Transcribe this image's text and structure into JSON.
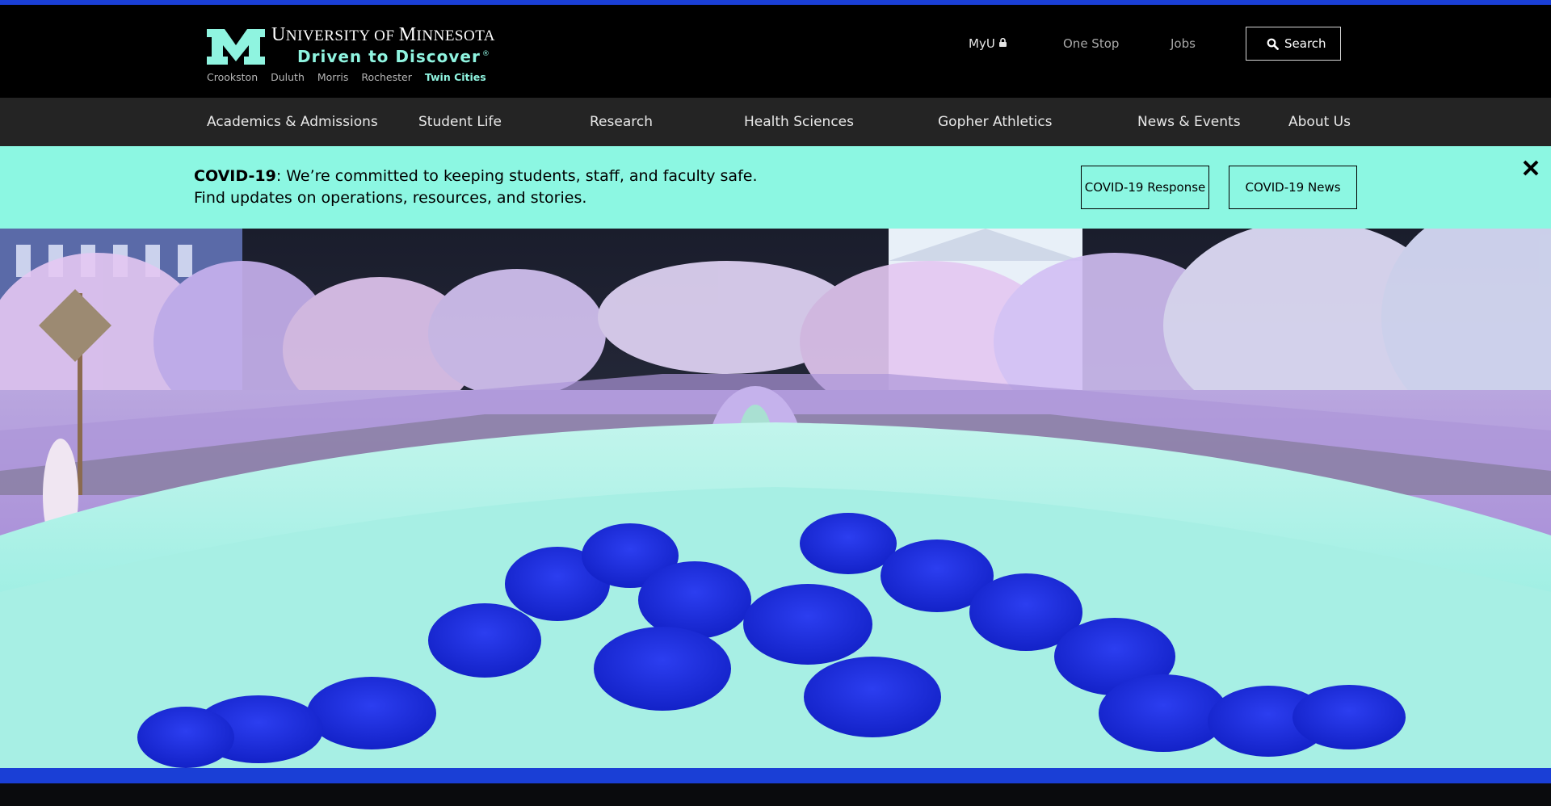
{
  "brand": {
    "university_first": "U",
    "university_rest": "NIVERSITY OF ",
    "university_second": "M",
    "university_second_rest": "INNESOTA",
    "tagline": "Driven to Discover",
    "tagline_mark": "®",
    "campuses": [
      {
        "label": "Crookston",
        "active": false
      },
      {
        "label": "Duluth",
        "active": false
      },
      {
        "label": "Morris",
        "active": false
      },
      {
        "label": "Rochester",
        "active": false
      },
      {
        "label": "Twin Cities",
        "active": true
      }
    ],
    "colors": {
      "accent": "#8ff4e0",
      "stripe": "#1a3fd6",
      "header_bg": "#000000"
    }
  },
  "utility_nav": {
    "myu": "MyU",
    "one_stop": "One Stop",
    "jobs": "Jobs",
    "search": "Search"
  },
  "main_nav": [
    "Academics & Admissions",
    "Student Life",
    "Research",
    "Health Sciences",
    "Gopher Athletics",
    "News & Events",
    "About Us"
  ],
  "alert": {
    "label": "COVID-19",
    "line1": ": We’re committed to keeping students, staff, and faculty safe.",
    "line2": "Find updates on operations, resources, and stories.",
    "buttons": [
      "COVID-19 Response",
      "COVID-19 News"
    ],
    "bg": "#8cf7e2"
  },
  "icons": {
    "lock": "lock-icon",
    "search": "search-icon",
    "close": "close-icon"
  }
}
